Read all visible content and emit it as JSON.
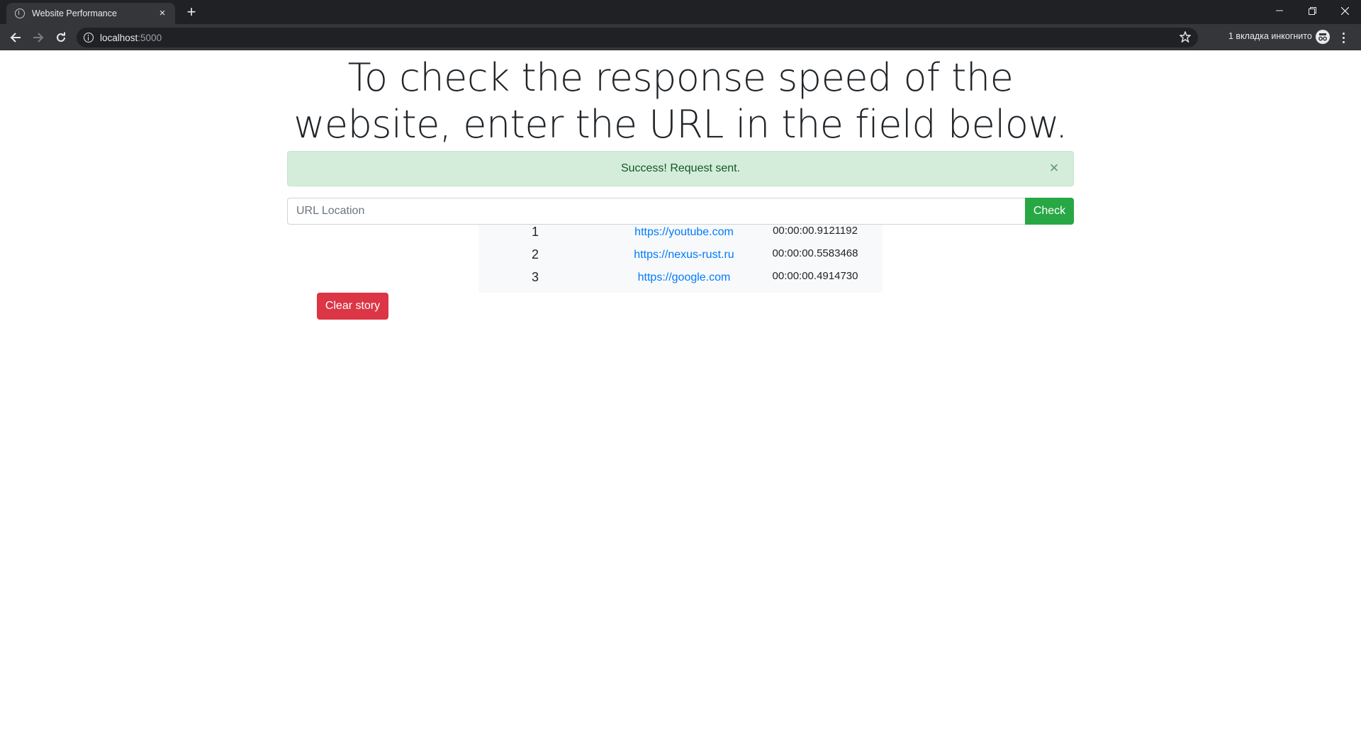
{
  "browser": {
    "tab_title": "Website Performance",
    "tab_close": "×",
    "new_tab": "+",
    "address_host": "localhost",
    "address_port": ":5000",
    "incognito_label": "1 вкладка инкогнито"
  },
  "page": {
    "heading": "To check the response speed of the website, enter the URL in the field below.",
    "alert": {
      "message": "Success! Request sent.",
      "close": "×",
      "color": "#d4edda"
    },
    "form": {
      "input_value": "",
      "input_placeholder": "URL Location",
      "check_label": "Check",
      "check_color": "#28a745"
    },
    "history": [
      {
        "num": "1",
        "url": "https://youtube.com",
        "time": "00:00:00.9121192"
      },
      {
        "num": "2",
        "url": "https://nexus-rust.ru",
        "time": "00:00:00.5583468"
      },
      {
        "num": "3",
        "url": "https://google.com",
        "time": "00:00:00.4914730"
      }
    ],
    "clear_label": "Clear story",
    "clear_color": "#dc3545",
    "link_color": "#007bff"
  }
}
